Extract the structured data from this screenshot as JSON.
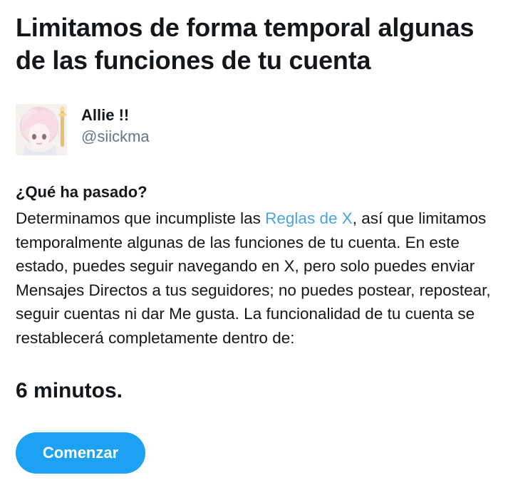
{
  "header": {
    "title": "Limitamos de forma temporal algunas de las funciones de tu cuenta"
  },
  "account": {
    "display_name": "Allie !!",
    "handle": "@siickma",
    "avatar_icon": "anime-avatar"
  },
  "details": {
    "heading": "¿Qué ha pasado?",
    "text_before_link": "Determinamos que incumpliste las ",
    "link_text": "Reglas de X",
    "text_after_link": ", así que limitamos temporalmente algunas de las funciones de tu cuenta. En este estado, puedes seguir navegando en X, pero solo puedes enviar Mensajes Directos a tus seguidores; no puedes postear, repostear, seguir cuentas ni dar Me gusta. La funcionalidad de tu cuenta se restablecerá completamente dentro de:"
  },
  "timer": {
    "text": "6 minutos."
  },
  "actions": {
    "start_label": "Comenzar"
  },
  "colors": {
    "link": "#4aa3df",
    "button": "#1da1f2",
    "secondary_text": "#657786"
  }
}
